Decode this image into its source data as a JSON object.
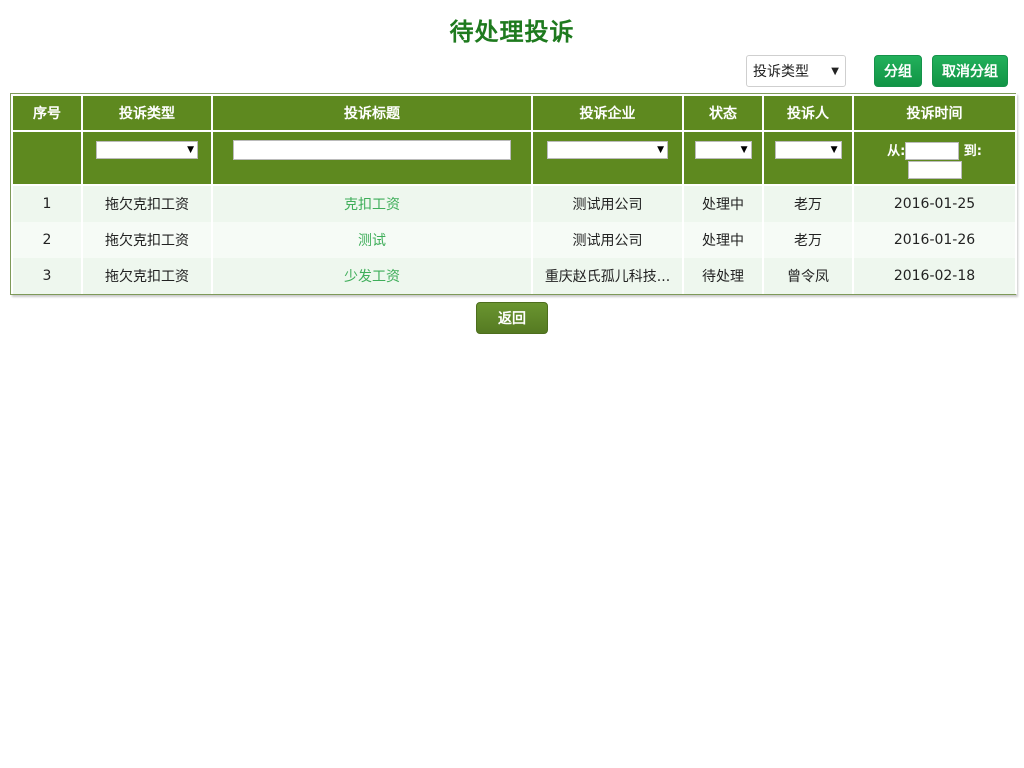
{
  "page": {
    "title": "待处理投诉"
  },
  "toolbar": {
    "group_select_value": "投诉类型",
    "group_button": "分组",
    "ungroup_button": "取消分组"
  },
  "table": {
    "headers": {
      "index": "序号",
      "type": "投诉类型",
      "title": "投诉标题",
      "company": "投诉企业",
      "status": "状态",
      "complainant": "投诉人",
      "time": "投诉时间"
    },
    "filter": {
      "from_label": "从:",
      "to_label": "到:"
    },
    "rows": [
      {
        "index": "1",
        "type": "拖欠克扣工资",
        "title": "克扣工资",
        "company": "测试用公司",
        "status": "处理中",
        "complainant": "老万",
        "time": "2016-01-25"
      },
      {
        "index": "2",
        "type": "拖欠克扣工资",
        "title": "测试",
        "company": "测试用公司",
        "status": "处理中",
        "complainant": "老万",
        "time": "2016-01-26"
      },
      {
        "index": "3",
        "type": "拖欠克扣工资",
        "title": "少发工资",
        "company": "重庆赵氏孤儿科技...",
        "status": "待处理",
        "complainant": "曾令凤",
        "time": "2016-02-18"
      }
    ]
  },
  "footer": {
    "return_button": "返回"
  }
}
